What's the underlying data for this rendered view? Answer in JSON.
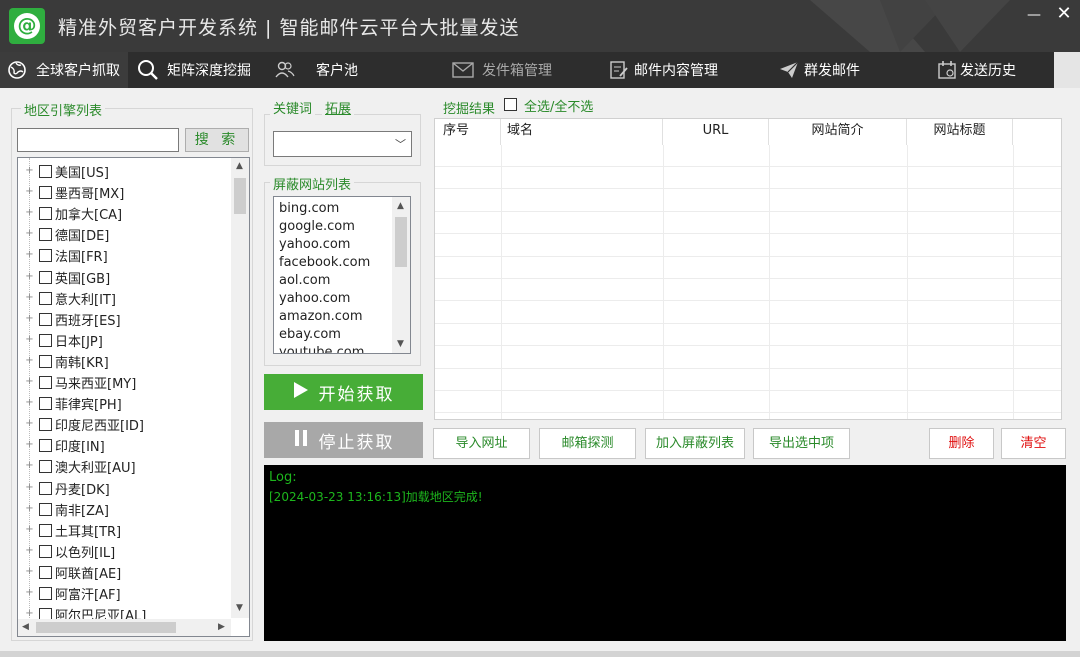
{
  "app": {
    "title": "精准外贸客户开发系统 | 智能邮件云平台大批量发送",
    "logo_glyph": "@",
    "minimize_glyph": "—",
    "close_glyph": "✕"
  },
  "nav": {
    "tabs": [
      {
        "label": "全球客户抓取",
        "icon": "globe-icon",
        "state": "active"
      },
      {
        "label": "矩阵深度挖掘",
        "icon": "search-icon",
        "state": "bright"
      },
      {
        "label": "客户池",
        "icon": "users-icon",
        "state": "bright"
      },
      {
        "label": "发件箱管理",
        "icon": "mail-icon",
        "state": "dim"
      },
      {
        "label": "邮件内容管理",
        "icon": "document-edit-icon",
        "state": "bright"
      },
      {
        "label": "群发邮件",
        "icon": "paper-plane-icon",
        "state": "bright"
      },
      {
        "label": "发送历史",
        "icon": "calendar-icon",
        "state": "bright"
      }
    ]
  },
  "region": {
    "legend": "地区引擎列表",
    "search_value": "",
    "search_button": "搜 索",
    "items": [
      "美国[US]",
      "墨西哥[MX]",
      "加拿大[CA]",
      "德国[DE]",
      "法国[FR]",
      "英国[GB]",
      "意大利[IT]",
      "西班牙[ES]",
      "日本[JP]",
      "南韩[KR]",
      "马来西亚[MY]",
      "菲律宾[PH]",
      "印度尼西亚[ID]",
      "印度[IN]",
      "澳大利亚[AU]",
      "丹麦[DK]",
      "南非[ZA]",
      "土耳其[TR]",
      "以色列[IL]",
      "阿联酋[AE]",
      "阿富汗[AF]",
      "阿尔巴尼亚[AL]"
    ]
  },
  "keyword": {
    "legend": "关键词",
    "expand_link": "拓展",
    "selected": ""
  },
  "blocked": {
    "legend": "屏蔽网站列表",
    "items": [
      "bing.com",
      "google.com",
      "yahoo.com",
      "facebook.com",
      "aol.com",
      "yahoo.com",
      "amazon.com",
      "ebay.com",
      "youtube.com"
    ]
  },
  "controls": {
    "start": "开始获取",
    "stop": "停止获取"
  },
  "results": {
    "legend": "挖掘结果",
    "select_all": "全选/全不选",
    "columns": [
      "序号",
      "域名",
      "URL",
      "网站简介",
      "网站标题"
    ]
  },
  "actions": {
    "import": "导入网址",
    "probe": "邮箱探测",
    "add_block": "加入屏蔽列表",
    "export": "导出选中项",
    "delete": "删除",
    "clear": "清空"
  },
  "log": {
    "label": "Log:",
    "lines": [
      "[2024-03-23 13:16:13]加载地区完成!"
    ]
  },
  "colors": {
    "accent_green": "#47ad37",
    "log_green": "#1db61d",
    "danger_red": "#e01010"
  }
}
